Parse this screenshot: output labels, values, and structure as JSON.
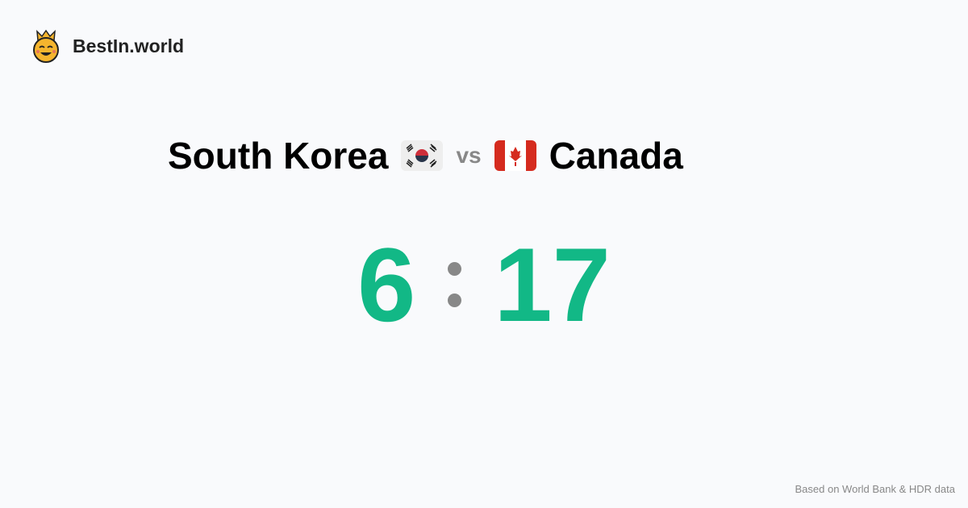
{
  "brand": {
    "name": "BestIn.world",
    "icon": "crown-smiley-icon"
  },
  "comparison": {
    "left": "South Korea",
    "vs": "vs",
    "right": "Canada"
  },
  "score": {
    "left": "6",
    "right": "17",
    "color": "#12b886"
  },
  "footer": "Based on World Bank & HDR data"
}
